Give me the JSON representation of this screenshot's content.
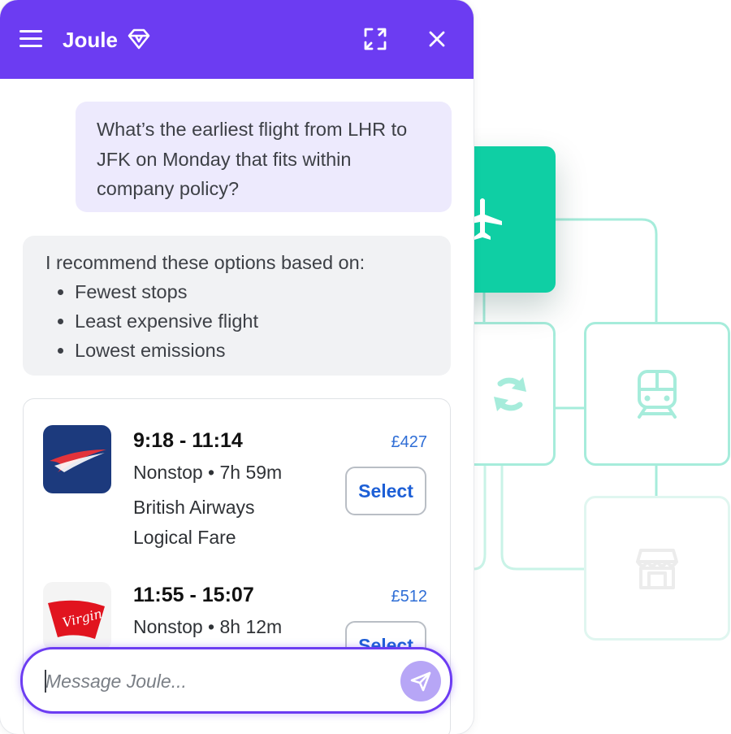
{
  "header": {
    "title": "Joule",
    "icons": [
      "menu-icon",
      "diamond-icon",
      "expand-icon",
      "close-icon"
    ]
  },
  "conversation": {
    "user_message": "What’s the earliest flight from LHR to JFK on Monday that fits within company policy?",
    "bot_intro": "I recommend these options based on:",
    "criteria": [
      "Fewest stops",
      "Least expensive flight",
      "Lowest emissions"
    ]
  },
  "flights": [
    {
      "time": "9:18 - 11:14",
      "stops_duration": "Nonstop • 7h 59m",
      "airline": "British Airways",
      "fare": "Logical Fare",
      "price": "£427",
      "select_label": "Select",
      "logo": "british-airways-logo"
    },
    {
      "time": "11:55 - 15:07",
      "stops_duration": "Nonstop • 8h 12m",
      "price": "£512",
      "select_label": "Select",
      "logo": "virgin-atlantic-logo",
      "logo_text": "Virgin"
    }
  ],
  "composer": {
    "placeholder": "Message Joule...",
    "send_icon": "send-icon"
  },
  "background_tiles": [
    "airplane-icon",
    "refresh-icon",
    "train-icon",
    "store-icon"
  ],
  "colors": {
    "brand": "#6c3cf2",
    "accent_teal": "#0fcfa4",
    "diagram_line": "#a6ecdb",
    "user_bubble": "#edeafd",
    "bot_bubble": "#f1f2f4",
    "price": "#2f6ed6",
    "select_text": "#1d5fd6",
    "send_button": "#b7a6f6"
  }
}
